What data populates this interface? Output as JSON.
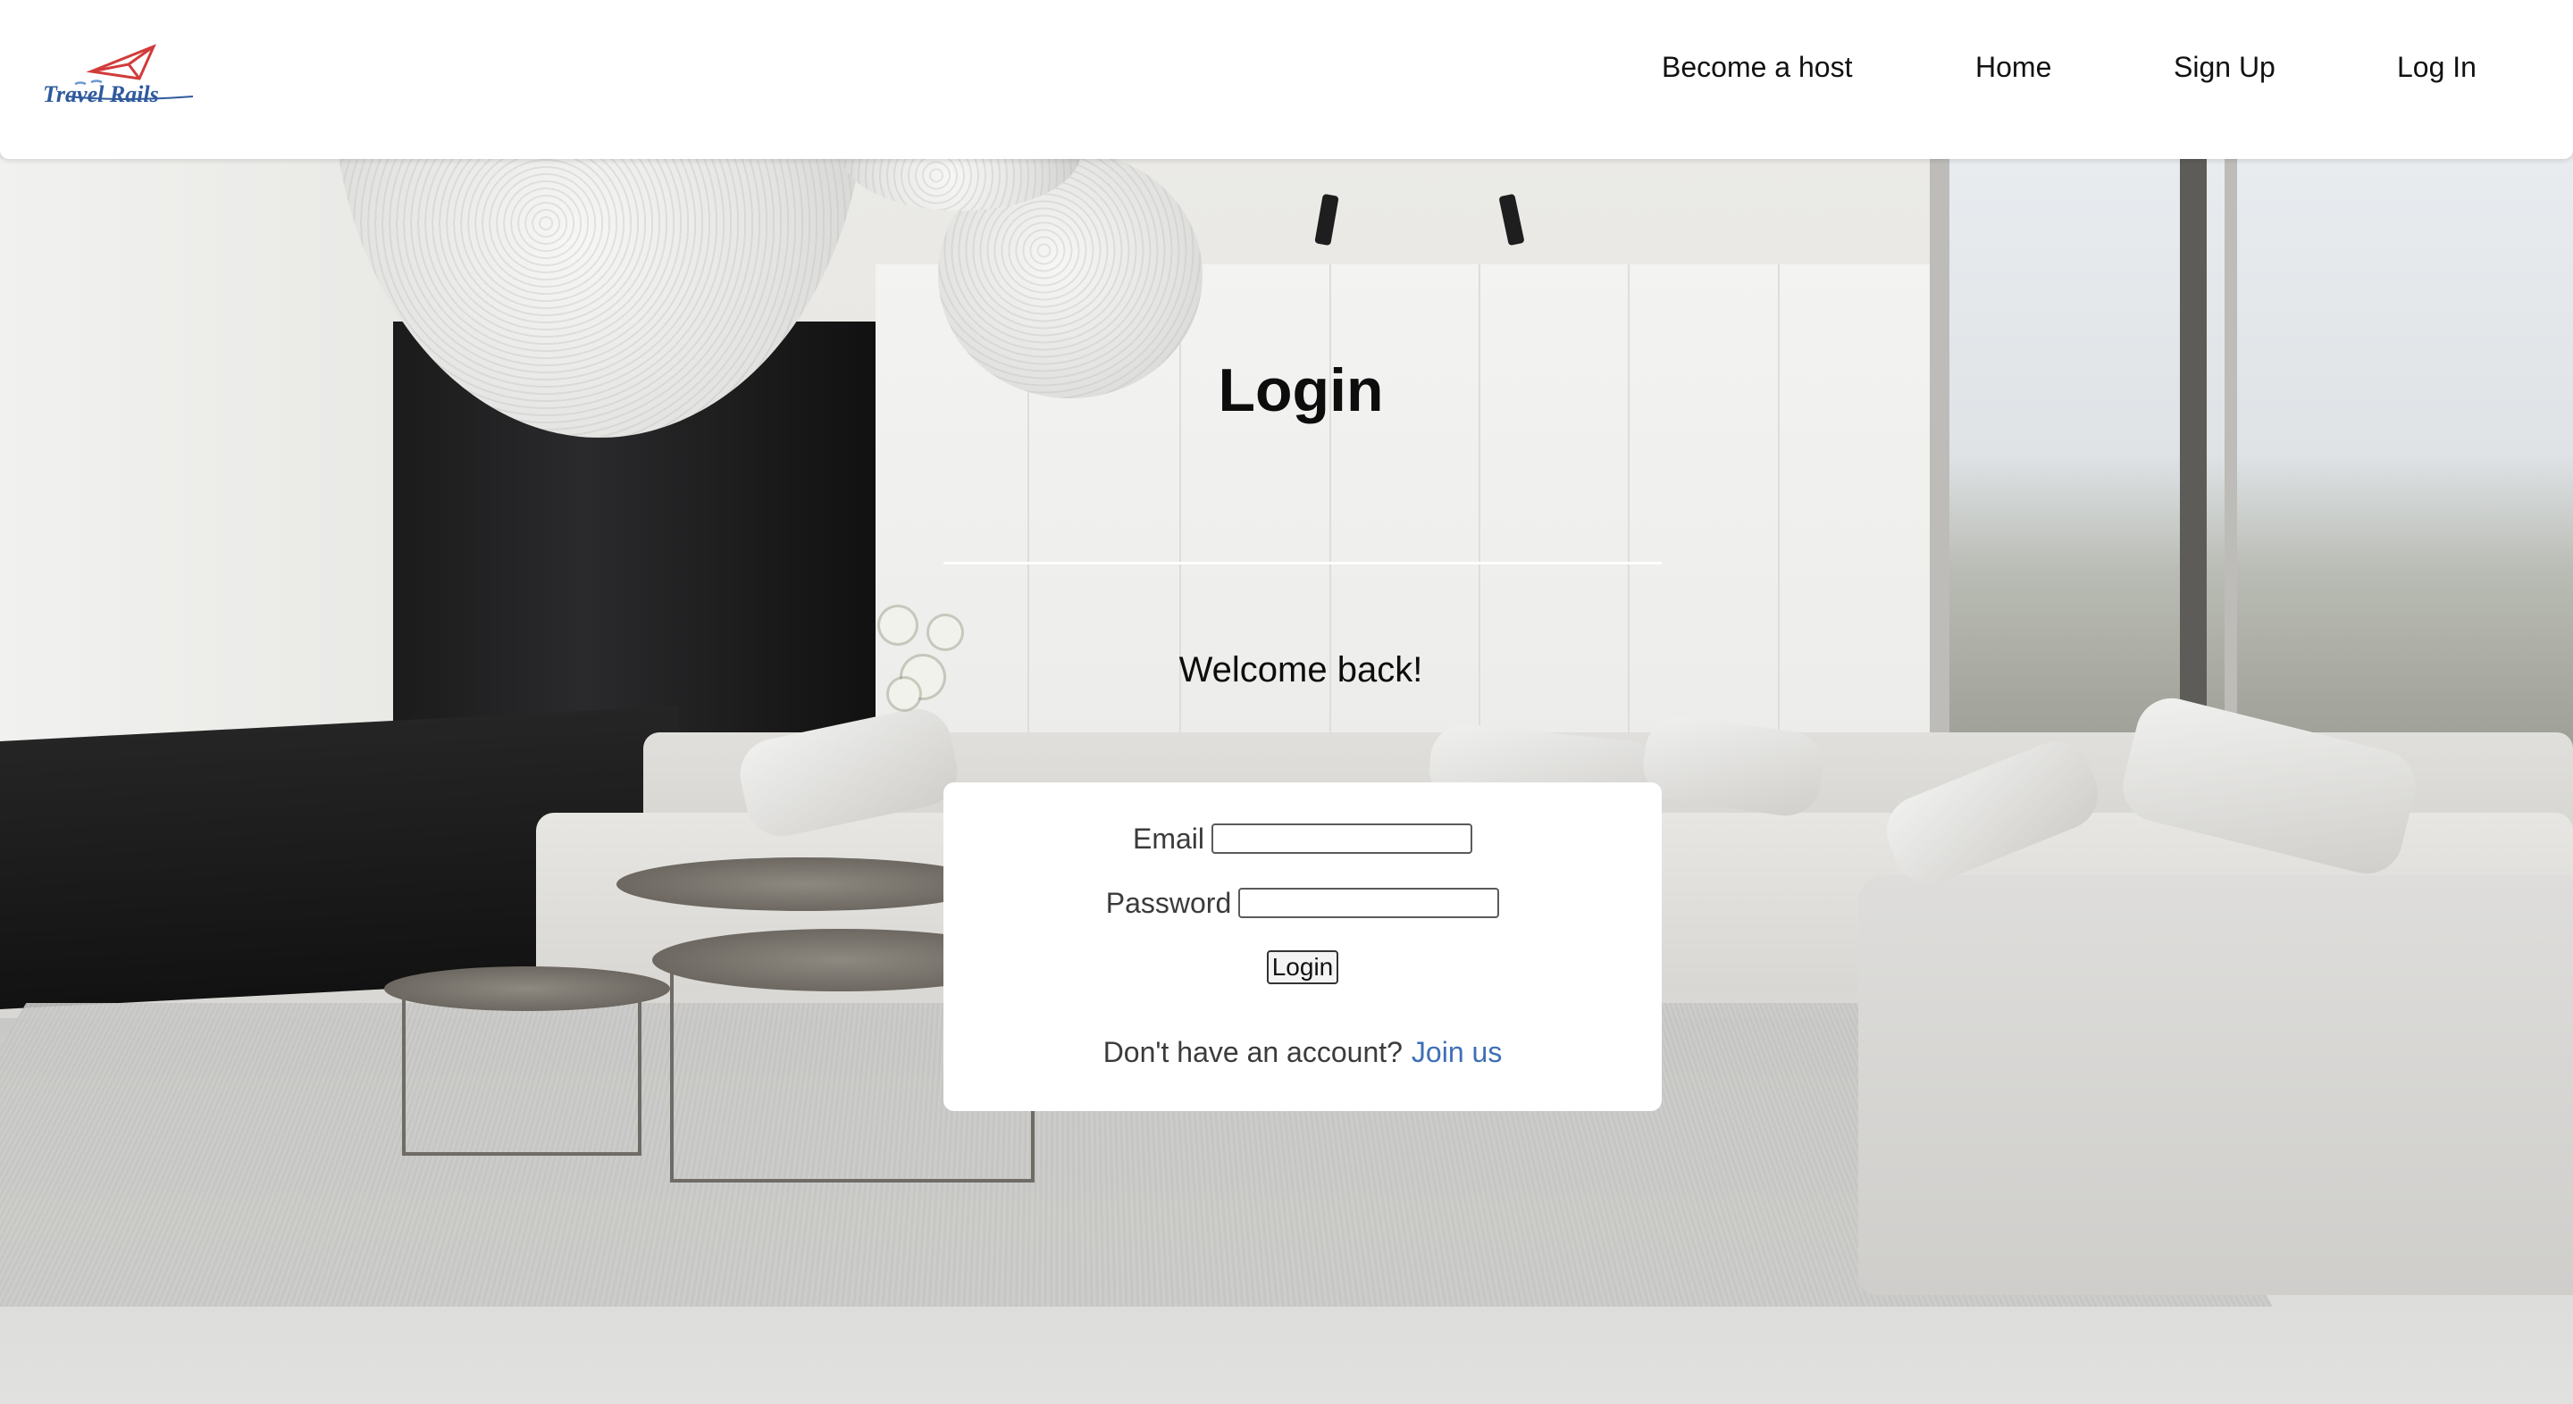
{
  "header": {
    "logo_text": "Travel Rails",
    "nav": {
      "become_host": "Become a host",
      "home": "Home",
      "sign_up": "Sign Up",
      "log_in": "Log In"
    }
  },
  "main": {
    "title": "Login",
    "welcome": "Welcome back!",
    "form": {
      "email_label": "Email",
      "email_value": "",
      "password_label": "Password",
      "password_value": "",
      "submit_label": "Login"
    },
    "signup_prompt": "Don't have an account?",
    "signup_link": "Join us"
  },
  "colors": {
    "link": "#3e6fb6",
    "logo_plane": "#d23b3b",
    "logo_text": "#2f5a9c"
  },
  "icons": {
    "logo": "paper-plane-icon"
  }
}
